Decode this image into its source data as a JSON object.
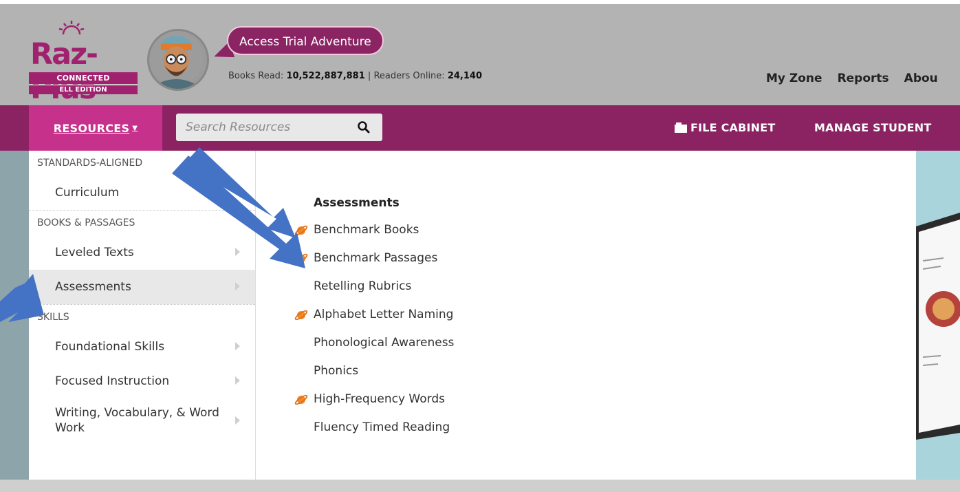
{
  "logo": {
    "name": "Raz-Plus",
    "line1": "CONNECTED CLASSROOM",
    "line2": "ELL EDITION"
  },
  "bubble": {
    "label": "Access Trial Adventure"
  },
  "stats": {
    "books_label": "Books Read:",
    "books_value": "10,522,887,881",
    "separator": "|",
    "readers_label": "Readers Online:",
    "readers_value": "24,140"
  },
  "topnav": [
    "My Zone",
    "Reports",
    "Abou"
  ],
  "bar": {
    "resources_label": "RESOURCES",
    "search_placeholder": "Search Resources",
    "file_cabinet": "FILE CABINET",
    "manage_students": "MANAGE STUDENT"
  },
  "menu": {
    "sections": [
      {
        "title": "STANDARDS-ALIGNED",
        "items": [
          "Curriculum"
        ]
      },
      {
        "title": "BOOKS & PASSAGES",
        "items": [
          "Leveled Texts",
          "Assessments"
        ]
      },
      {
        "title": "SKILLS",
        "items": [
          "Foundational Skills",
          "Focused Instruction",
          "Writing, Vocabulary, & Word Work"
        ]
      }
    ],
    "active_item": "Assessments"
  },
  "submenu": {
    "title": "Assessments",
    "items": [
      {
        "label": "Benchmark Books",
        "icon": "planet-icon"
      },
      {
        "label": "Benchmark Passages",
        "icon": "planet-icon"
      },
      {
        "label": "Retelling Rubrics",
        "icon": ""
      },
      {
        "label": "Alphabet Letter Naming",
        "icon": "planet-icon"
      },
      {
        "label": "Phonological Awareness",
        "icon": ""
      },
      {
        "label": "Phonics",
        "icon": ""
      },
      {
        "label": "High-Frequency Words",
        "icon": "planet-icon"
      },
      {
        "label": "Fluency Timed Reading",
        "icon": ""
      }
    ]
  },
  "colors": {
    "header_bg": "#b3b3b3",
    "brand_purple": "#8b2262",
    "resources_pink": "#c5318b",
    "annotation_arrow": "#4472c4",
    "planet_orange": "#f0892a"
  }
}
